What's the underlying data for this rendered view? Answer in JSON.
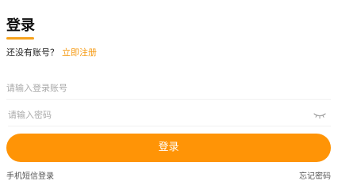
{
  "title": "登录",
  "signup": {
    "prompt": "还没有账号？",
    "link_label": "立即注册"
  },
  "form": {
    "account_placeholder": "请输入登录账号",
    "account_value": "",
    "password_placeholder": "请输入密码",
    "password_value": "",
    "password_toggle_icon": "eye-closed-icon"
  },
  "login_button_label": "登录",
  "footer": {
    "sms_login_label": "手机短信登录",
    "forgot_password_label": "忘记密码"
  },
  "colors": {
    "accent": "#ff9406",
    "link": "#f59a13",
    "underline": "#f7a21b",
    "text": "#111111",
    "placeholder": "#aaaaaa"
  }
}
